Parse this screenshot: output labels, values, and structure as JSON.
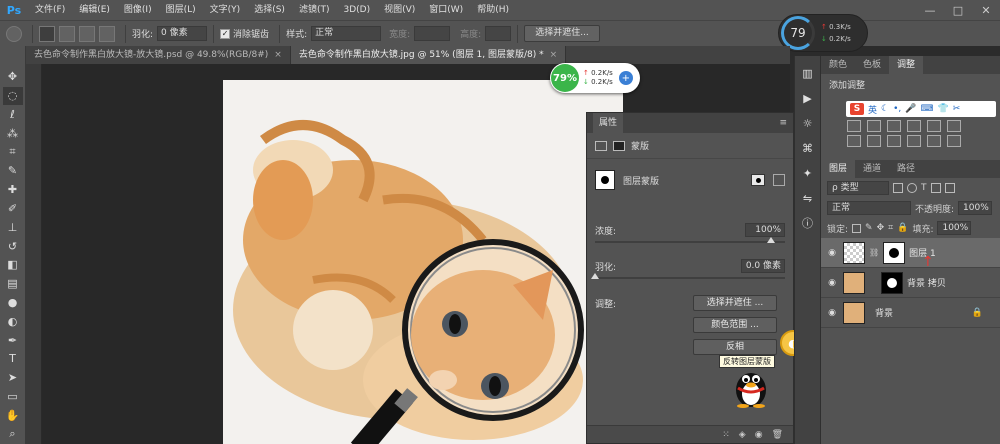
{
  "app": {
    "logo": "Ps"
  },
  "menu": [
    "文件(F)",
    "编辑(E)",
    "图像(I)",
    "图层(L)",
    "文字(Y)",
    "选择(S)",
    "滤镜(T)",
    "3D(D)",
    "视图(V)",
    "窗口(W)",
    "帮助(H)"
  ],
  "window_controls": {
    "minimize": "—",
    "maximize": "□",
    "close": "✕"
  },
  "options": {
    "feather_label": "羽化:",
    "feather_value": "0 像素",
    "antialias_label": "消除锯齿",
    "style_label": "样式:",
    "style_value": "正常",
    "width_label": "宽度:",
    "height_label": "高度:",
    "select_mask_button": "选择并遮住..."
  },
  "tabs": [
    {
      "label": "去色命令制作黑白放大镜-放大镜.psd @ 49.8%(RGB/8#)",
      "close": "×"
    },
    {
      "label": "去色命令制作黑白放大镜.jpg @ 51% (图层 1, 图层蒙版/8) *",
      "close": "×"
    }
  ],
  "speed_widget": {
    "percent": "79%",
    "up": "0.2K/s",
    "down": "0.2K/s",
    "plus": "+"
  },
  "speed_widget_top": {
    "percent": "79",
    "up": "0.3K/s",
    "down": "0.2K/s"
  },
  "properties": {
    "title": "属性",
    "mask_section": "蒙版",
    "layer_mask_label": "图层蒙版",
    "density_label": "浓度:",
    "density_value": "100%",
    "density": 1.0,
    "feather_label": "羽化:",
    "feather_value": "0.0 像素",
    "feather": 0.0,
    "adjust_label": "调整:",
    "btn_select_mask": "选择并遮住 ...",
    "btn_color_range": "颜色范围 ...",
    "btn_invert": "反相",
    "tooltip": "反转图层蒙版",
    "menu_icon": "≡"
  },
  "right_panel": {
    "top_tabs": [
      "颜色",
      "色板",
      "调整"
    ],
    "active_top": "调整",
    "adjust_title": "添加调整",
    "ime": {
      "logo": "S",
      "text": "英"
    },
    "layer_tabs": [
      "图层",
      "通道",
      "路径"
    ],
    "active_layer_tab": "图层",
    "kind_label": "ρ 类型",
    "blend_mode": "正常",
    "opacity_label": "不透明度:",
    "opacity_value": "100%",
    "lock_label": "锁定:",
    "fill_label": "填充:",
    "fill_value": "100%",
    "layers": [
      {
        "name": "图层 1",
        "selected": true
      },
      {
        "name": "背景 拷贝",
        "selected": false
      },
      {
        "name": "背景",
        "selected": false,
        "locked": true
      }
    ]
  },
  "icons": [
    "move-icon",
    "marquee-icon",
    "lasso-icon",
    "magic-wand-icon",
    "crop-icon",
    "eyedropper-icon",
    "healing-icon",
    "brush-icon",
    "stamp-icon",
    "history-brush-icon",
    "eraser-icon",
    "gradient-icon",
    "blur-icon",
    "dodge-icon",
    "pen-icon",
    "type-icon",
    "path-select-icon",
    "shape-icon",
    "hand-icon",
    "zoom-icon"
  ]
}
